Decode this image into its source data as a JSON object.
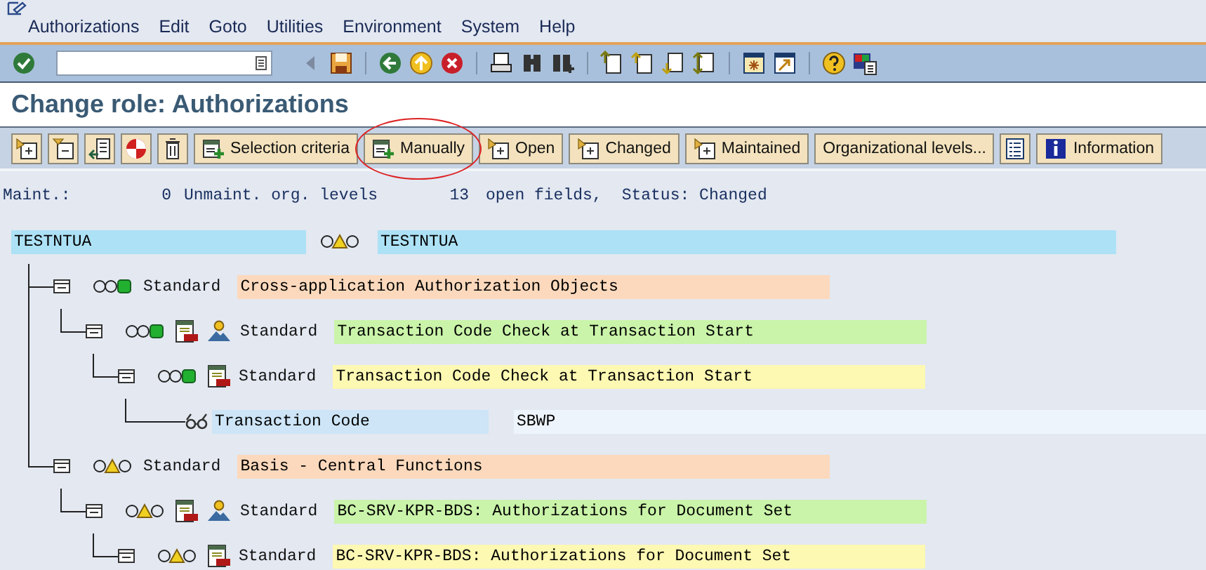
{
  "menu": [
    "Authorizations",
    "Edit",
    "Goto",
    "Utilities",
    "Environment",
    "System",
    "Help"
  ],
  "title": "Change role: Authorizations",
  "app_toolbar": [
    {
      "label": "Selection criteria",
      "circled": false
    },
    {
      "label": "Manually",
      "circled": true
    },
    {
      "label": "Open",
      "circled": false
    },
    {
      "label": "Changed",
      "circled": false
    },
    {
      "label": "Maintained",
      "circled": false
    },
    {
      "label": "Organizational levels...",
      "circled": false
    },
    {
      "label": "Information",
      "circled": false
    }
  ],
  "summary": {
    "maint_label": "Maint.:",
    "unmaint_count": "0",
    "unmaint_label": "Unmaint. org. levels",
    "open_count": "13",
    "open_label": "open fields,",
    "status": "Status: Changed"
  },
  "tree": {
    "kind": "role",
    "name": "TESTNTUA",
    "complete": false,
    "text": "TESTNTUA",
    "children": [
      {
        "kind": "class",
        "complete": true,
        "label": "Standard",
        "text": "Cross-application Authorization Objects",
        "children": [
          {
            "kind": "object",
            "complete": true,
            "label": "Standard",
            "text": "Transaction Code Check at Transaction Start",
            "children": [
              {
                "kind": "authorization",
                "complete": true,
                "label": "Standard",
                "text": "Transaction Code Check at Transaction Start",
                "children": [
                  {
                    "kind": "field",
                    "label": "Transaction Code",
                    "text": "SBWP"
                  }
                ]
              }
            ]
          }
        ]
      },
      {
        "kind": "class",
        "complete": false,
        "label": "Standard",
        "text": "Basis - Central Functions",
        "children": [
          {
            "kind": "object",
            "complete": false,
            "label": "Standard",
            "text": "BC-SRV-KPR-BDS: Authorizations for Document Set",
            "children": [
              {
                "kind": "authorization",
                "complete": false,
                "label": "Standard",
                "text": "BC-SRV-KPR-BDS: Authorizations for Document Set"
              }
            ]
          }
        ]
      }
    ]
  }
}
